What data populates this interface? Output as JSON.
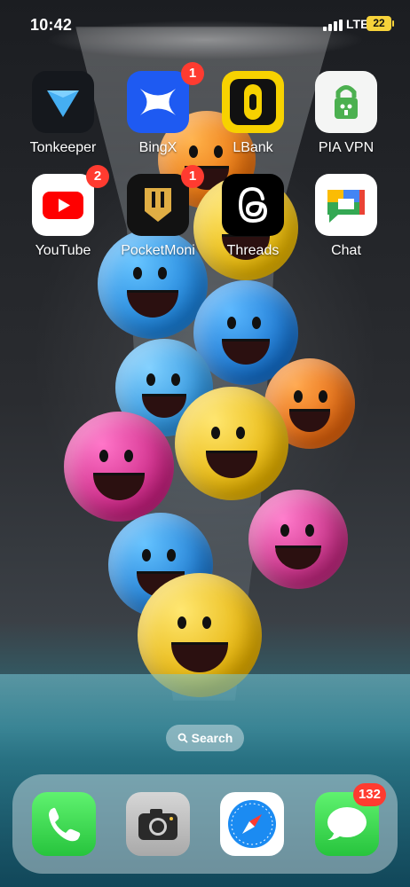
{
  "status_bar": {
    "time": "10:42",
    "network": "LTE",
    "battery": "22"
  },
  "home_grid": [
    {
      "name": "Tonkeeper",
      "icon": "tonkeeper-icon",
      "badge": null
    },
    {
      "name": "BingX",
      "icon": "bingx-icon",
      "badge": "1"
    },
    {
      "name": "LBank",
      "icon": "lbank-icon",
      "badge": null
    },
    {
      "name": "PIA VPN",
      "icon": "pia-vpn-icon",
      "badge": null
    },
    {
      "name": "YouTube",
      "icon": "youtube-icon",
      "badge": "2"
    },
    {
      "name": "PocketMoni",
      "icon": "pocketmoni-icon",
      "badge": "1"
    },
    {
      "name": "Threads",
      "icon": "threads-icon",
      "badge": null
    },
    {
      "name": "Chat",
      "icon": "google-chat-icon",
      "badge": null
    }
  ],
  "search": {
    "label": "Search"
  },
  "dock": [
    {
      "name": "Phone",
      "icon": "phone-icon",
      "badge": null
    },
    {
      "name": "Camera",
      "icon": "camera-icon",
      "badge": null
    },
    {
      "name": "Safari",
      "icon": "safari-icon",
      "badge": null
    },
    {
      "name": "Messages",
      "icon": "messages-icon",
      "badge": "132"
    }
  ],
  "colors": {
    "badge": "#ff3b30",
    "battery": "#f6d23a"
  }
}
